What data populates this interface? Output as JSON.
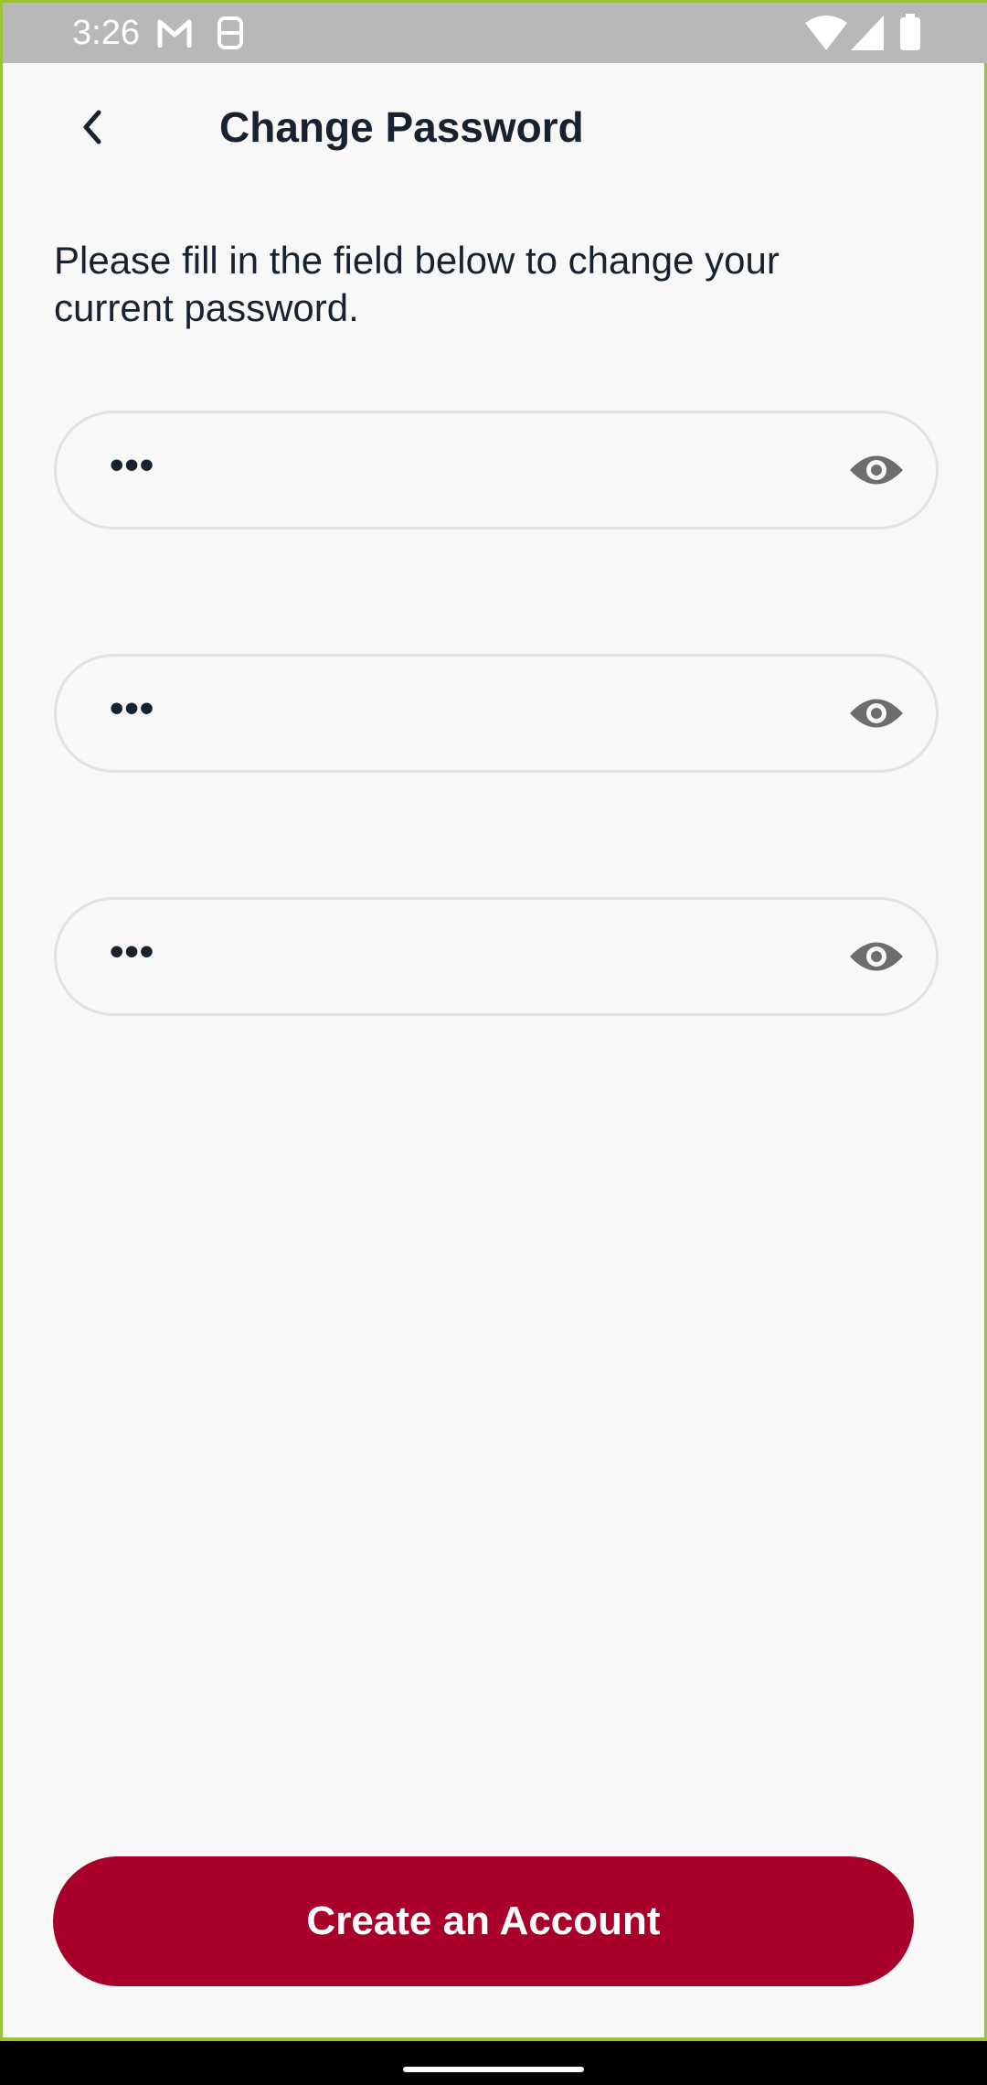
{
  "status_bar": {
    "time": "3:26",
    "left_icons": [
      "gmail-icon",
      "sim-alert-icon"
    ],
    "right_icons": [
      "wifi-icon",
      "signal-icon",
      "battery-icon"
    ]
  },
  "header": {
    "title": "Change Password",
    "back_icon": "chevron-left-icon"
  },
  "intro": {
    "line1": "Please fill in the field below to change your",
    "line2": "current password."
  },
  "fields": [
    {
      "value": "•••",
      "toggle_icon": "eye-icon"
    },
    {
      "value": "•••",
      "toggle_icon": "eye-icon"
    },
    {
      "value": "•••",
      "toggle_icon": "eye-icon"
    }
  ],
  "submit": {
    "label": "Create an Account"
  },
  "colors": {
    "accent": "#a8002a",
    "background": "#f8f8f9",
    "text": "#18222e",
    "status_bar": "#b8b8b8",
    "field_border": "#e2e2e4",
    "icon_gray": "#6d6d6d"
  }
}
